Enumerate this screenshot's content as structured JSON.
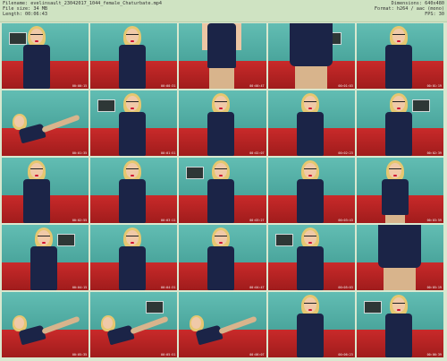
{
  "header": {
    "filename_line": "Filename: evelinsault_23042017_1044_female_Chaturbate.mp4",
    "filesize_line": "File size: 34 MB",
    "length_line": "Length: 00:06:43",
    "dimensions_line": "Dimensions: 640x480",
    "format_line": "Format: h264 / aac (mono)",
    "fps_line": "FPS: 30"
  },
  "thumbnails": [
    {
      "timestamp": "00:00:15",
      "pose": "portrait-wide"
    },
    {
      "timestamp": "00:00:31",
      "pose": "portrait"
    },
    {
      "timestamp": "00:00:47",
      "pose": "closeup-torso"
    },
    {
      "timestamp": "00:01:03",
      "pose": "closeup-skirt"
    },
    {
      "timestamp": "00:01:19",
      "pose": "portrait"
    },
    {
      "timestamp": "00:01:35",
      "pose": "reclining"
    },
    {
      "timestamp": "00:01:51",
      "pose": "portrait"
    },
    {
      "timestamp": "00:02:07",
      "pose": "portrait"
    },
    {
      "timestamp": "00:02:23",
      "pose": "portrait"
    },
    {
      "timestamp": "00:02:39",
      "pose": "portrait"
    },
    {
      "timestamp": "00:02:55",
      "pose": "portrait-wide"
    },
    {
      "timestamp": "00:03:11",
      "pose": "portrait"
    },
    {
      "timestamp": "00:03:27",
      "pose": "portrait"
    },
    {
      "timestamp": "00:03:43",
      "pose": "portrait-tilt"
    },
    {
      "timestamp": "00:03:59",
      "pose": "standing"
    },
    {
      "timestamp": "00:04:15",
      "pose": "portrait"
    },
    {
      "timestamp": "00:04:31",
      "pose": "portrait"
    },
    {
      "timestamp": "00:04:47",
      "pose": "portrait"
    },
    {
      "timestamp": "00:05:03",
      "pose": "portrait"
    },
    {
      "timestamp": "00:05:19",
      "pose": "closeup-skirt"
    },
    {
      "timestamp": "00:05:35",
      "pose": "reclining"
    },
    {
      "timestamp": "00:05:51",
      "pose": "kneeling"
    },
    {
      "timestamp": "00:06:07",
      "pose": "reclining"
    },
    {
      "timestamp": "00:06:23",
      "pose": "portrait"
    },
    {
      "timestamp": "00:06:39",
      "pose": "portrait"
    }
  ],
  "colors": {
    "wall": "#5ab3aa",
    "sofa": "#c02525",
    "dress": "#1b2447",
    "hair": "#e6c770",
    "header_bg": "#cfe3c2"
  }
}
